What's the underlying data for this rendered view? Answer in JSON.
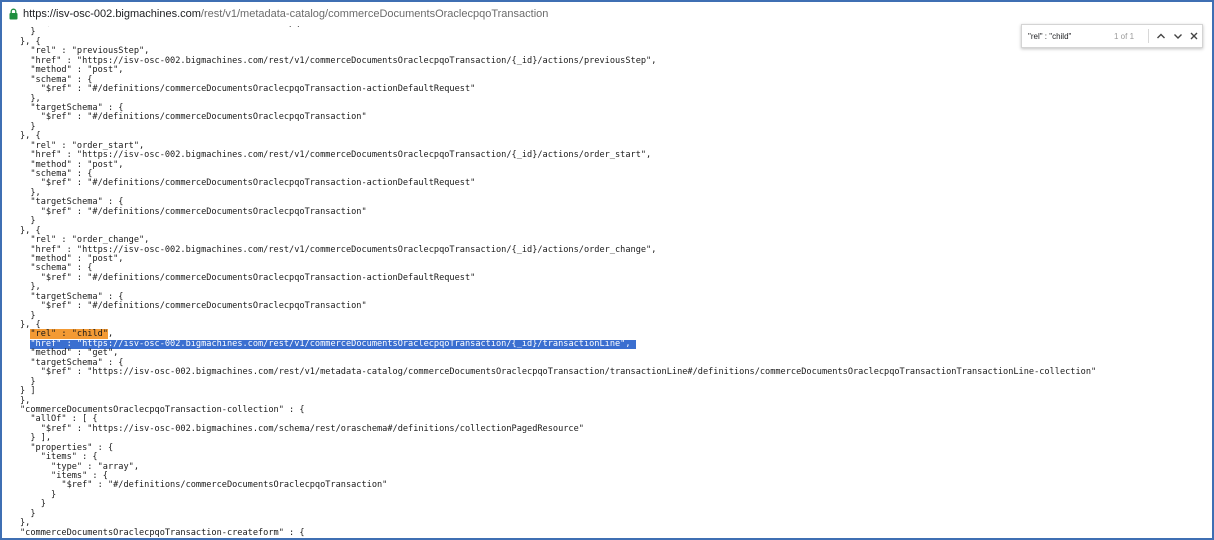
{
  "addressbar": {
    "url_host": "https://isv-osc-002.bigmachines.com",
    "url_path": "/rest/v1/metadata-catalog/commerceDocumentsOraclecpqoTransaction"
  },
  "findbar": {
    "query": "\"rel\" : \"child\"",
    "count": "1 of 1",
    "icons": [
      "chevron-up-icon",
      "chevron-down-icon",
      "close-icon"
    ]
  },
  "colors": {
    "selection": "#3b6fd0",
    "match": "#f39a34",
    "frame": "#3f6fb3"
  },
  "json_lines": [
    "    \"$ref\" : \"#/definitions/commerceDocumentsOraclecpqoTransaction\"",
    "  }",
    "}, {",
    "  \"rel\" : \"previousStep\",",
    "  \"href\" : \"https://isv-osc-002.bigmachines.com/rest/v1/commerceDocumentsOraclecpqoTransaction/{_id}/actions/previousStep\",",
    "  \"method\" : \"post\",",
    "  \"schema\" : {",
    "    \"$ref\" : \"#/definitions/commerceDocumentsOraclecpqoTransaction-actionDefaultRequest\"",
    "  },",
    "  \"targetSchema\" : {",
    "    \"$ref\" : \"#/definitions/commerceDocumentsOraclecpqoTransaction\"",
    "  }",
    "}, {",
    "  \"rel\" : \"order_start\",",
    "  \"href\" : \"https://isv-osc-002.bigmachines.com/rest/v1/commerceDocumentsOraclecpqoTransaction/{_id}/actions/order_start\",",
    "  \"method\" : \"post\",",
    "  \"schema\" : {",
    "    \"$ref\" : \"#/definitions/commerceDocumentsOraclecpqoTransaction-actionDefaultRequest\"",
    "  },",
    "  \"targetSchema\" : {",
    "    \"$ref\" : \"#/definitions/commerceDocumentsOraclecpqoTransaction\"",
    "  }",
    "}, {",
    "  \"rel\" : \"order_change\",",
    "  \"href\" : \"https://isv-osc-002.bigmachines.com/rest/v1/commerceDocumentsOraclecpqoTransaction/{_id}/actions/order_change\",",
    "  \"method\" : \"post\",",
    "  \"schema\" : {",
    "    \"$ref\" : \"#/definitions/commerceDocumentsOraclecpqoTransaction-actionDefaultRequest\"",
    "  },",
    "  \"targetSchema\" : {",
    "    \"$ref\" : \"#/definitions/commerceDocumentsOraclecpqoTransaction\"",
    "  }",
    "}, {",
    "  \"rel\" : \"child\",",
    "  \"href\" : \"https://isv-osc-002.bigmachines.com/rest/v1/commerceDocumentsOraclecpqoTransaction/{_id}/transactionLine\",",
    "  \"method\" : \"get\",",
    "  \"targetSchema\" : {",
    "    \"$ref\" : \"https://isv-osc-002.bigmachines.com/rest/v1/metadata-catalog/commerceDocumentsOraclecpqoTransaction/transactionLine#/definitions/commerceDocumentsOraclecpqoTransactionTransactionLine-collection\"",
    "  }",
    "} ]",
    "},",
    "\"commerceDocumentsOraclecpqoTransaction-collection\" : {",
    "  \"allOf\" : [ {",
    "    \"$ref\" : \"https://isv-osc-002.bigmachines.com/schema/rest/oraschema#/definitions/collectionPagedResource\"",
    "  } ],",
    "  \"properties\" : {",
    "    \"items\" : {",
    "      \"type\" : \"array\",",
    "      \"items\" : {",
    "        \"$ref\" : \"#/definitions/commerceDocumentsOraclecpqoTransaction\"",
    "      }",
    "    }",
    "  }",
    "},",
    "\"commerceDocumentsOraclecpqoTransaction-createform\" : {"
  ],
  "highlight": {
    "match_line": 33,
    "match_text": "\"rel\" : \"child\"",
    "selected_line": 34
  }
}
